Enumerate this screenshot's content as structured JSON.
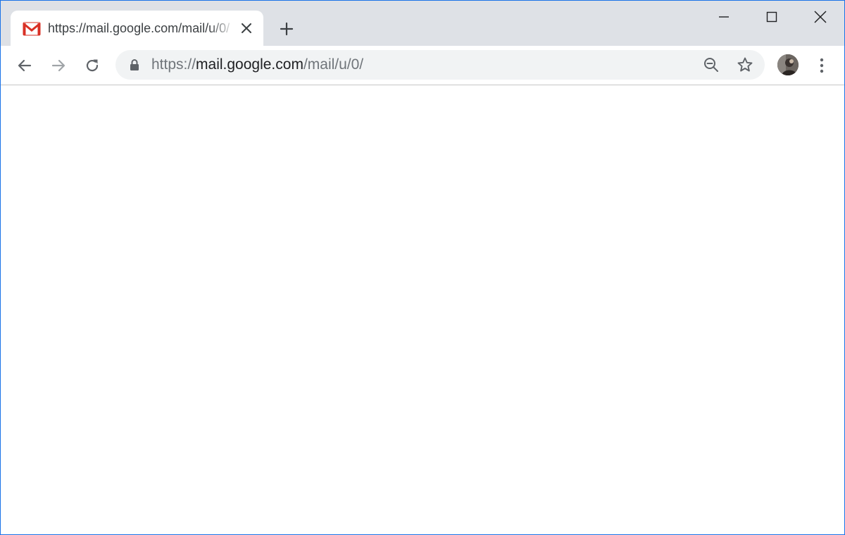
{
  "tab": {
    "title": "https://mail.google.com/mail/u/0/",
    "favicon": "gmail-icon",
    "close_icon": "close-icon"
  },
  "new_tab_icon": "plus-icon",
  "window_controls": [
    "minimize-icon",
    "maximize-icon",
    "close-icon"
  ],
  "toolbar": {
    "back_icon": "arrow-left-icon",
    "forward_icon": "arrow-right-icon",
    "reload_icon": "reload-icon",
    "menu_icon": "kebab-menu-icon"
  },
  "omnibox": {
    "lock_icon": "lock-icon",
    "url_scheme": "https://",
    "url_host": "mail.google.com",
    "url_path": "/mail/u/0/",
    "zoom_icon": "zoom-out-icon",
    "bookmark_icon": "star-icon"
  },
  "colors": {
    "tabstrip_bg": "#dee1e6",
    "omnibox_bg": "#f1f3f4",
    "window_border": "#1a73e8",
    "gmail_red": "#d93025",
    "icon_gray": "#5f6368",
    "disabled_gray": "#a0a4a8"
  }
}
